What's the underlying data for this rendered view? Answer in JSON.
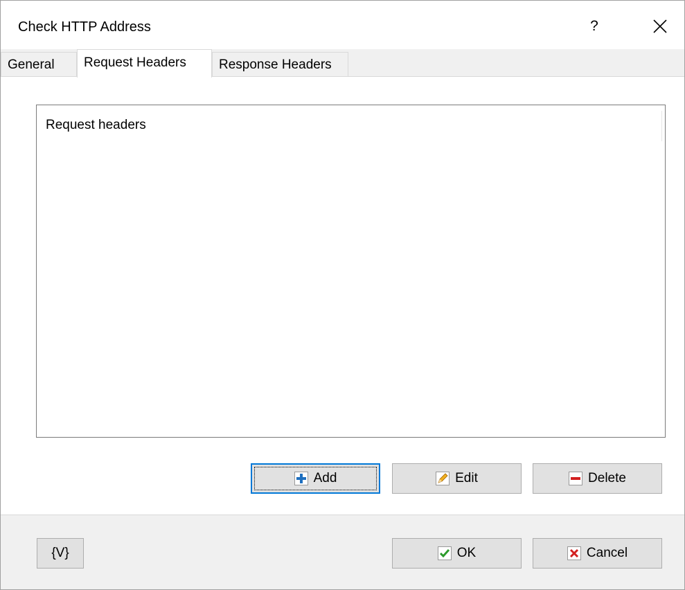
{
  "window": {
    "title": "Check HTTP Address",
    "help_label": "?"
  },
  "tabs": [
    {
      "label": "General"
    },
    {
      "label": "Request Headers"
    },
    {
      "label": "Response Headers"
    }
  ],
  "list": {
    "header": "Request headers",
    "items": []
  },
  "list_buttons": {
    "add": "Add",
    "edit": "Edit",
    "delete": "Delete"
  },
  "footer": {
    "variables": "{V}",
    "ok": "OK",
    "cancel": "Cancel"
  },
  "colors": {
    "accent": "#0078d7",
    "add_icon": "#1e6fbf",
    "delete_icon": "#d32020",
    "ok_icon": "#2b9a2b",
    "cancel_icon": "#d32020"
  }
}
